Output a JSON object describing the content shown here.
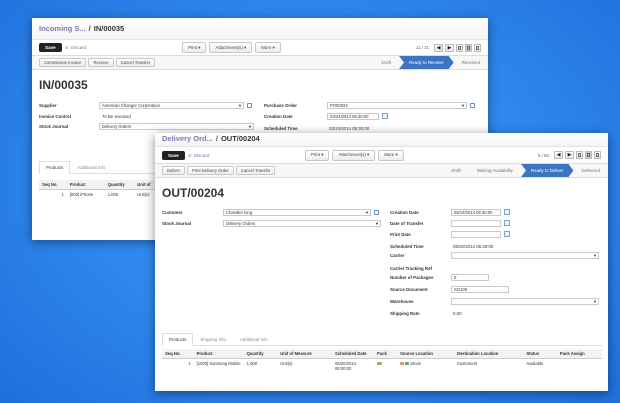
{
  "back": {
    "breadcrumb": {
      "parent": "Incoming S...",
      "sep": "/",
      "current": "IN/00035"
    },
    "toolbar": {
      "save": "Save",
      "or": "or",
      "discard": "Discard",
      "print": "Print ▾",
      "attachments": "Attachment(s) ▾",
      "more": "More ▾",
      "pager": "11 / 31",
      "prev": "◀",
      "next": "▶"
    },
    "status_buttons": [
      "Commission Invoice",
      "Receive",
      "Cancel Transfer"
    ],
    "stages": [
      "Draft",
      "Ready to Receive",
      "Received"
    ],
    "active_stage": "Ready to Receive",
    "title": "IN/00035",
    "fields": {
      "supplier_label": "Supplier",
      "supplier": "American Changer Corporation",
      "invoice_label": "Invoice Control",
      "invoice": "To Be Invoiced",
      "journal_label": "Stock Journal",
      "journal": "Delivery Orders",
      "po_label": "Purchase Order",
      "po": "PO00022",
      "creation_label": "Creation Date",
      "creation": "03/24/2014 05:30:00",
      "sched_label": "Scheduled Time",
      "sched": "03/24/2014 05:30:00"
    },
    "tabs": [
      "Products",
      "Additional Info"
    ],
    "table": {
      "headers": [
        "Seq No.",
        "Product",
        "Quantity",
        "Unit of"
      ],
      "rows": [
        [
          "1",
          "[000] iPhone",
          "1.000",
          "Unit(s)"
        ]
      ]
    }
  },
  "front": {
    "breadcrumb": {
      "parent": "Delivery Ord...",
      "sep": "/",
      "current": "OUT/00204"
    },
    "toolbar": {
      "save": "Save",
      "or": "or",
      "discard": "Discard",
      "print": "Print ▾",
      "attachments": "Attachment(s) ▾",
      "more": "More ▾",
      "pager": "5 / 80",
      "prev": "◀",
      "next": "▶"
    },
    "status_buttons": [
      "Deliver",
      "Print Delivery Order",
      "Cancel Transfer"
    ],
    "stages": [
      "Draft",
      "Waiting Availability",
      "Ready to Deliver",
      "Delivered"
    ],
    "active_stage": "Ready to Deliver",
    "title": "OUT/00204",
    "fields": {
      "customer_label": "Customer",
      "customer": "Chandler long",
      "journal_label": "Stock Journal",
      "journal": "Delivery Orders",
      "creation_label": "Creation Date",
      "creation": "05/13/2014 06:30:00",
      "transfer_label": "Date of Transfer",
      "transfer": "",
      "print_label": "Print Date",
      "print": "",
      "sched_label": "Scheduled Time",
      "sched": "05/20/2014 06:30:00",
      "carrier_label": "Carrier",
      "carrier": "",
      "tracking_label": "Carrier Tracking Ref",
      "packages_label": "Number of Packages",
      "packages": "0",
      "source_label": "Source Document",
      "source": "SO109",
      "warehouse_label": "Warehouse",
      "warehouse": "",
      "rate_label": "Shipping Rate",
      "rate": "0.00"
    },
    "tabs": [
      "Products",
      "Shipping Info",
      "Additional Info"
    ],
    "table": {
      "headers": [
        "Seq.No.",
        "Product",
        "Quantity",
        "Unit of Measure",
        "Scheduled Date",
        "Pack",
        "Source Location",
        "Destination Location",
        "Status",
        "Pack Assign"
      ],
      "rows": [
        [
          "1",
          "[1000] Samsung Mobile",
          "1.000",
          "Unit(s)",
          "05/20/2014 06:00:00",
          "",
          "Stock",
          "Customers",
          "Available",
          ""
        ]
      ]
    }
  },
  "colors": {
    "accent": "#3c73c4",
    "link": "#7c7bad",
    "background": "#2d86ec"
  }
}
